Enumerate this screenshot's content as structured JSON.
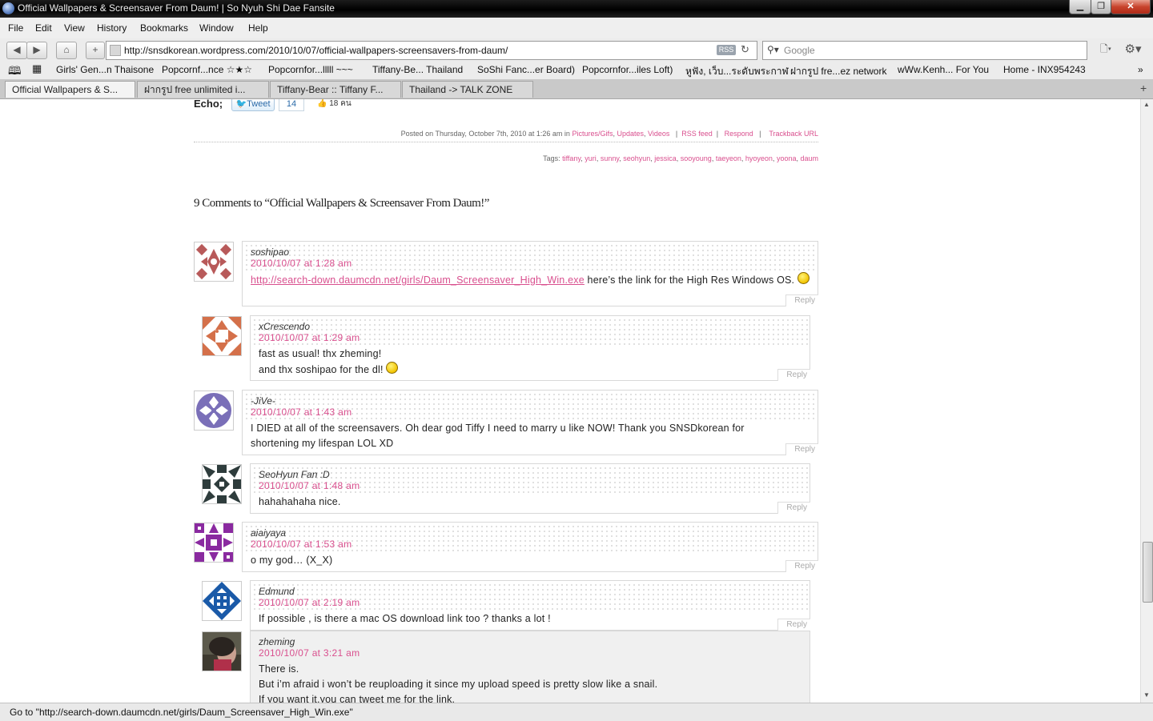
{
  "window": {
    "title": "Official Wallpapers & Screensaver From Daum! | So Nyuh Shi Dae Fansite"
  },
  "menu": [
    "File",
    "Edit",
    "View",
    "History",
    "Bookmarks",
    "Window",
    "Help"
  ],
  "nav": {
    "url": "http://snsdkorean.wordpress.com/2010/10/07/official-wallpapers-screensavers-from-daum/",
    "rss_label": "RSS",
    "search_placeholder": "Google"
  },
  "bookmarks": [
    "Girls' Gen...n Thaisone",
    "Popcornf...nce ☆★☆",
    "Popcornfor...lllll ~~~",
    "Tiffany-Be... Thailand",
    "SoShi Fanc...er Board)",
    "Popcornfor...iles Loft)",
    "หูฟัง, เว็บ...ระดับพระกาฬ",
    "ฝากรูป fre...ez network",
    "wWw.Kenh... For You",
    "Home - INX954243"
  ],
  "tabs": [
    {
      "label": "Official Wallpapers & S...",
      "active": true
    },
    {
      "label": "ฝากรูป free unlimited i...",
      "active": false
    },
    {
      "label": "Tiffany-Bear :: Tiffany F...",
      "active": false
    },
    {
      "label": "Thailand -> TALK ZONE",
      "active": false
    }
  ],
  "post": {
    "echo_label": "Echo;",
    "tweet_label": "Tweet",
    "tweet_count": "14",
    "like_label": "18 คน",
    "meta_prefix": "Posted on Thursday, October 7th, 2010 at 1:26 am in",
    "categories": [
      "Pictures/Gifs",
      "Updates",
      "Videos"
    ],
    "rss_feed": "RSS feed",
    "respond": "Respond",
    "trackback": "Trackback URL",
    "tags_label": "Tags:",
    "tags": [
      "tiffany",
      "yuri",
      "sunny",
      "seohyun",
      "jessica",
      "sooyoung",
      "taeyeon",
      "hyoyeon",
      "yoona",
      "daum"
    ]
  },
  "comments_title": "9 Comments to “Official Wallpapers & Screensaver From Daum!”",
  "comments": [
    {
      "author": "soshipao",
      "date": "2010/10/07 at 1:28 am",
      "link": "http://search-down.daumcdn.net/girls/Daum_Screensaver_High_Win.exe",
      "text": " here’s the link for the High Res Windows OS. ",
      "reply": "Reply",
      "avatar_color": "#b85a5a"
    },
    {
      "author": "xCrescendo",
      "date": "2010/10/07 at 1:29 am",
      "lines": [
        "fast as usual! thx zheming!",
        "and thx soshipao for the dl! "
      ],
      "reply": "Reply",
      "avatar_color": "#d4704a"
    },
    {
      "author": "-JiVe-",
      "date": "2010/10/07 at 1:43 am",
      "text": "I DIED at all of the screensavers. Oh dear god Tiffy I need to marry u like NOW! Thank you SNSDkorean for shortening my lifespan LOL XD",
      "reply": "Reply",
      "avatar_color": "#7a6fb8"
    },
    {
      "author": "SeoHyun Fan :D",
      "date": "2010/10/07 at 1:48 am",
      "text": "hahahahaha nice.",
      "reply": "Reply",
      "avatar_color": "#2e3c3c"
    },
    {
      "author": "aiaiyaya",
      "date": "2010/10/07 at 1:53 am",
      "text": "o my god… (X_X)",
      "reply": "Reply",
      "avatar_color": "#8a2aa0"
    },
    {
      "author": "Edmund",
      "date": "2010/10/07 at 2:19 am",
      "text": "If possible , is there a mac OS download link too ? thanks a lot !",
      "reply": "Reply",
      "avatar_color": "#1a5aa8"
    },
    {
      "author": "zheming",
      "date": "2010/10/07 at 3:21 am",
      "lines": [
        "There is.",
        "But i’m afraid i won’t be reuploading it since my upload speed is pretty slow like a snail.",
        "If you want it,you can tweet me for the link."
      ],
      "avatar_color": "#6a6a5a"
    }
  ],
  "status": "Go to \"http://search-down.daumcdn.net/girls/Daum_Screensaver_High_Win.exe\""
}
